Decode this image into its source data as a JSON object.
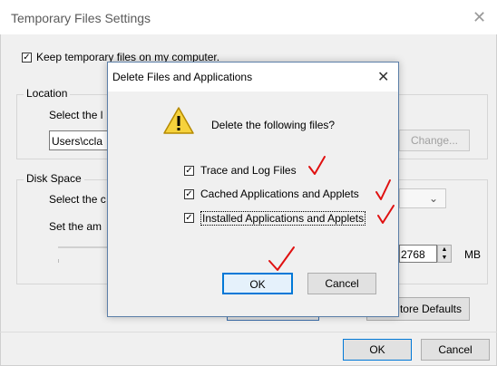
{
  "background_window": {
    "title": "Temporary Files Settings",
    "keep_label": "Keep temporary files on my computer.",
    "location": {
      "legend": "Location",
      "select_label": "Select the l",
      "path_value": "Users\\ccla",
      "change_button": "Change..."
    },
    "disk_space": {
      "legend": "Disk Space",
      "select_label": "Select the c",
      "set_label": "Set the am",
      "amount_value": "2768",
      "unit": "MB"
    },
    "restore_button": "tore Defaults",
    "ok_button": "OK",
    "cancel_button": "Cancel"
  },
  "dialog": {
    "title": "Delete Files and Applications",
    "message": "Delete the following files?",
    "options": [
      {
        "label": "Trace and Log Files",
        "checked": true
      },
      {
        "label": "Cached Applications and Applets",
        "checked": true
      },
      {
        "label": "Installed Applications and Applets",
        "checked": true
      }
    ],
    "ok_button": "OK",
    "cancel_button": "Cancel"
  },
  "colors": {
    "annotation": "#e01010",
    "accent": "#0078d7"
  }
}
